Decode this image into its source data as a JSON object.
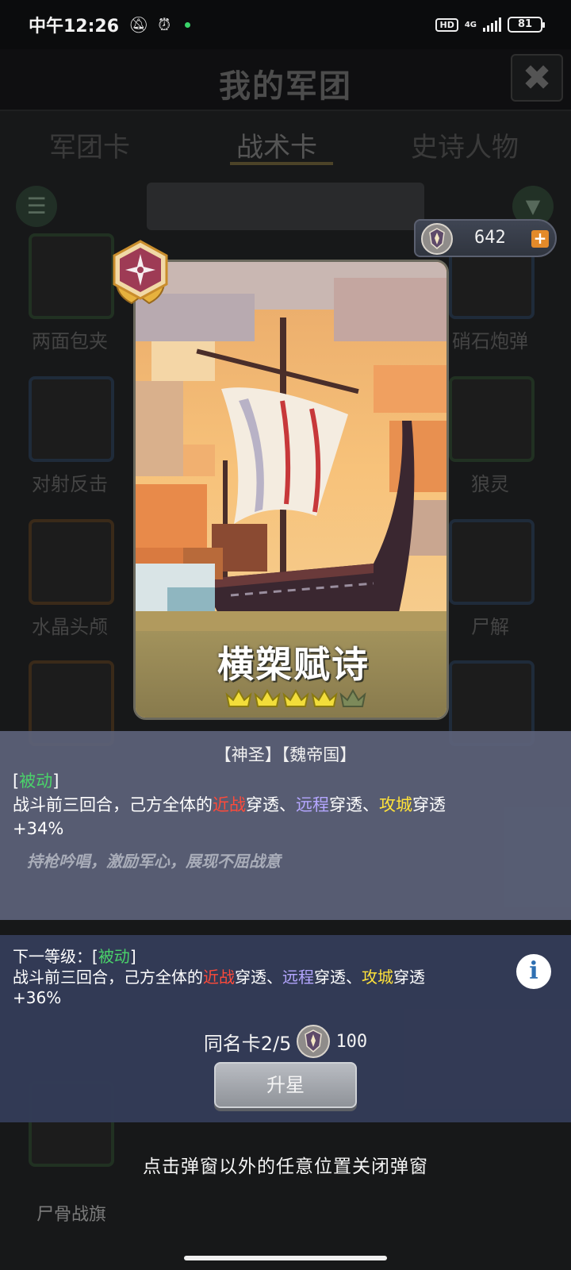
{
  "status_bar": {
    "time": "中午12:26",
    "network": "4G",
    "hd_label": "HD",
    "battery": "81"
  },
  "background_screen": {
    "title": "我的军团",
    "tabs": [
      "军团卡",
      "战术卡",
      "史诗人物"
    ],
    "active_tab": "战术卡",
    "card_labels": {
      "r1_left": "两面包夹",
      "r1_right": "硝石炮弹",
      "r2_left": "对射反击",
      "r2_right": "狼灵",
      "r3_left": "水晶头颅",
      "r3_right": "尸解",
      "bottom_left": "尸骨战旗"
    }
  },
  "currency": {
    "amount": "642",
    "icon": "laurel-shield-icon",
    "add_icon": "plus-icon"
  },
  "card": {
    "name": "横槊赋诗",
    "stars_filled": 4,
    "stars_total": 5,
    "rank_badge_icon": "compass-laurel-badge-icon",
    "accent_color": "#f3b46a"
  },
  "current_level": {
    "tags": "【神圣】【魏帝国】",
    "type_open": "[",
    "type": "被动",
    "type_close": "]",
    "text_prefix": "战斗前三回合，己方全体的",
    "term_melee": "近战",
    "penetrate1": "穿透、",
    "term_ranged": "远程",
    "penetrate2": "穿透、",
    "term_siege": "攻城",
    "penetrate3": "穿透",
    "value": "+34%",
    "flavor": "持枪吟唱，激励军心，展现不屈战意"
  },
  "next_level": {
    "label": "下一等级：[",
    "type": "被动",
    "type_close": "]",
    "text_prefix": "战斗前三回合，己方全体的",
    "term_melee": "近战",
    "penetrate1": "穿透、",
    "term_ranged": "远程",
    "penetrate2": "穿透、",
    "term_siege": "攻城",
    "penetrate3": "穿透",
    "value": "+36%"
  },
  "duplicates": {
    "label": "同名卡2/5",
    "cost": "100"
  },
  "upgrade_button": "升星",
  "close_hint": "点击弹窗以外的任意位置关闭弹窗",
  "colors": {
    "passive": "#4ad36a",
    "melee": "#ff4a3a",
    "ranged": "#b4a6ff",
    "siege": "#ffe23a"
  }
}
